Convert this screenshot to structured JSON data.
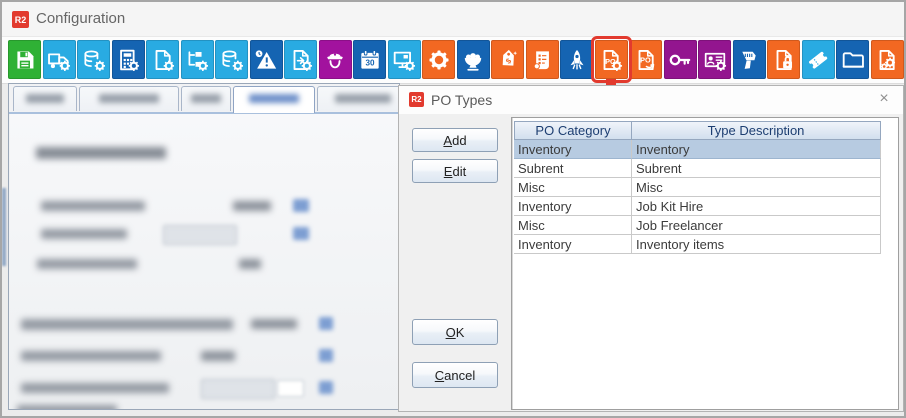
{
  "titlebar": {
    "logo": "R2",
    "title": "Configuration"
  },
  "toolbar": {
    "icons": [
      {
        "name": "save",
        "glyph": "floppy",
        "color": "#2fb135"
      },
      {
        "name": "delivery-settings",
        "glyph": "truck",
        "color": "#29abe2",
        "gear": true
      },
      {
        "name": "currency-settings",
        "glyph": "coins",
        "color": "#29abe2",
        "gear": true
      },
      {
        "name": "calculator-settings",
        "glyph": "calc",
        "color": "#1564b2",
        "gear": true
      },
      {
        "name": "document-settings",
        "glyph": "doc",
        "color": "#29abe2",
        "gear": true
      },
      {
        "name": "workflow-settings",
        "glyph": "tree",
        "color": "#29abe2",
        "gear": true
      },
      {
        "name": "database-settings",
        "glyph": "coins",
        "color": "#29abe2",
        "gear": true
      },
      {
        "name": "time-alert",
        "glyph": "clockwarn",
        "color": "#1564b2"
      },
      {
        "name": "document-transfer-settings",
        "glyph": "docarrow",
        "color": "#29abe2",
        "gear": true
      },
      {
        "name": "security-officer",
        "glyph": "officer",
        "color": "#a2129e"
      },
      {
        "name": "calendar-30",
        "glyph": "cal30",
        "color": "#1564b2",
        "label": "30"
      },
      {
        "name": "monitor-settings",
        "glyph": "monitor",
        "color": "#29abe2",
        "gear": true
      },
      {
        "name": "settings-gear",
        "glyph": "gearbig",
        "color": "#f26822"
      },
      {
        "name": "banquet-bowl",
        "glyph": "bowl",
        "color": "#1564b2"
      },
      {
        "name": "price-tag",
        "glyph": "tag",
        "color": "#f26822",
        "label": "$"
      },
      {
        "name": "contract-list",
        "glyph": "scroll",
        "color": "#f26822"
      },
      {
        "name": "rocket",
        "glyph": "rocket",
        "color": "#1564b2"
      },
      {
        "name": "po-types",
        "glyph": "podoc",
        "color": "#f26822",
        "gear": true,
        "label": "PO",
        "highlight": true
      },
      {
        "name": "po-process",
        "glyph": "poarrow",
        "color": "#f26822",
        "label": "PO"
      },
      {
        "name": "access-key",
        "glyph": "key",
        "color": "#93158f"
      },
      {
        "name": "id-card-settings",
        "glyph": "card",
        "color": "#93158f",
        "gear": true
      },
      {
        "name": "barcode-scanner",
        "glyph": "scanner",
        "color": "#1564b2"
      },
      {
        "name": "document-lock",
        "glyph": "doclock",
        "color": "#f26822"
      },
      {
        "name": "ticket",
        "glyph": "ticket",
        "color": "#29abe2"
      },
      {
        "name": "folder",
        "glyph": "folder",
        "color": "#1564b2"
      },
      {
        "name": "document-gears",
        "glyph": "docgears",
        "color": "#f26822"
      }
    ]
  },
  "annotation": {
    "color": "#e23a2e",
    "highlighted_icon": "po-types"
  },
  "background_window": {
    "tab_count": 5,
    "selected_tab_index": 3
  },
  "dialog": {
    "logo": "R2",
    "title": "PO Types",
    "close_glyph": "×",
    "buttons": {
      "add": "Add",
      "edit": "Edit",
      "ok": "OK",
      "cancel": "Cancel"
    },
    "table": {
      "columns": [
        "PO Category",
        "Type Description"
      ],
      "rows": [
        [
          "Inventory",
          "Inventory"
        ],
        [
          "Subrent",
          "Subrent"
        ],
        [
          "Misc",
          "Misc"
        ],
        [
          "Inventory",
          "Job Kit Hire"
        ],
        [
          "Misc",
          "Job Freelancer"
        ],
        [
          "Inventory",
          "Inventory items"
        ]
      ],
      "selected_row_index": 0
    }
  },
  "colors": {
    "selected_row": "#b7cbe1",
    "header_text": "#1d3e71",
    "annotation_red": "#e23a2e"
  }
}
